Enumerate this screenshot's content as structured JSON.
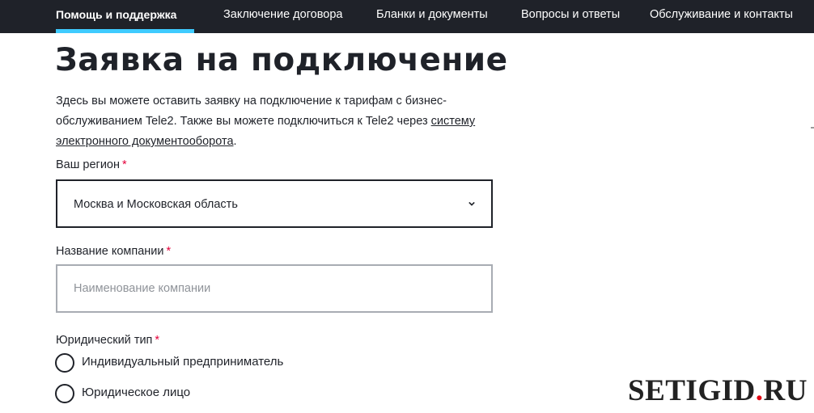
{
  "nav": {
    "items": [
      {
        "label": "Помощь и поддержка",
        "active": true
      },
      {
        "label": "Заключение договора",
        "active": false
      },
      {
        "label": "Бланки и документы",
        "active": false
      },
      {
        "label": "Вопросы и ответы",
        "active": false
      },
      {
        "label": "Обслуживание и контакты",
        "active": false
      }
    ],
    "accent_color": "#3fcbff"
  },
  "page": {
    "title": "Заявка на подключение",
    "intro_text": "Здесь вы можете оставить заявку на подключение к тарифам с бизнес-обслуживанием Tele2. Также вы можете подключиться к Tele2 через ",
    "intro_link": "систему электронного документооборота",
    "intro_end": "."
  },
  "form": {
    "region": {
      "label": "Ваш регион",
      "required_mark": "*",
      "value": "Москва и Московская область",
      "icon": "chevron-down-icon"
    },
    "company": {
      "label": "Название компании",
      "required_mark": "*",
      "value": "",
      "placeholder": "Наименование компании"
    },
    "legal_type": {
      "label": "Юридический тип",
      "required_mark": "*",
      "options": [
        {
          "label": "Индивидуальный предприниматель",
          "checked": false
        },
        {
          "label": "Юридическое лицо",
          "checked": false
        }
      ]
    }
  },
  "watermark": {
    "text_part1": "SETIGID",
    "text_dot": ".",
    "text_part2": "RU",
    "dot_color": "#e30613"
  },
  "colors": {
    "header_bg": "#1f2229",
    "required": "#e4003a"
  }
}
